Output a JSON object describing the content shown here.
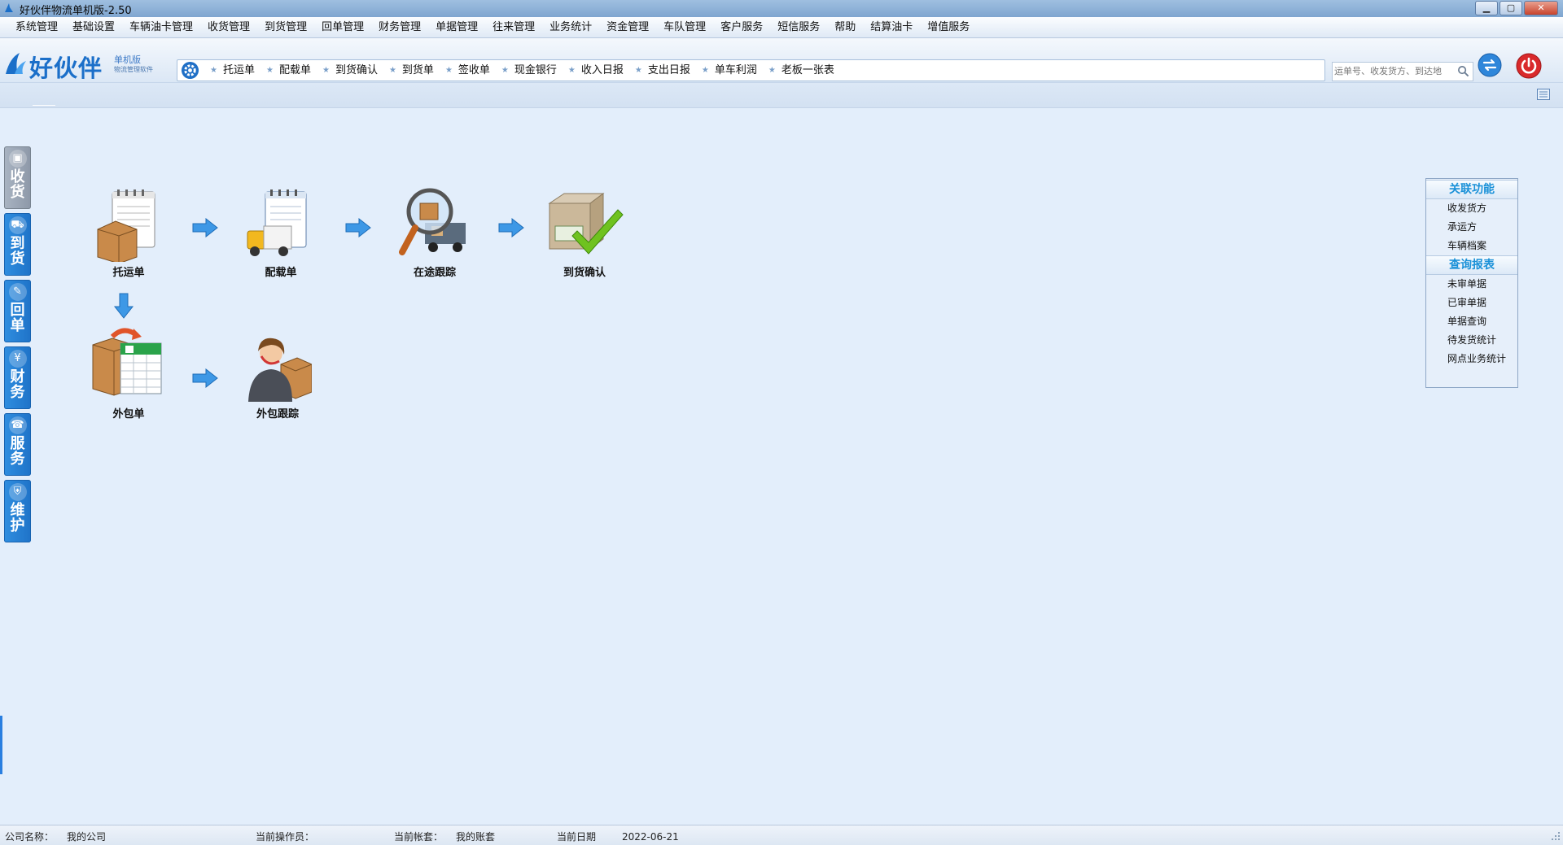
{
  "window": {
    "title": "好伙伴物流单机版-2.50",
    "controls": [
      "minimize-icon",
      "maximize-icon",
      "close-icon"
    ]
  },
  "menu": [
    "系统管理",
    "基础设置",
    "车辆油卡管理",
    "收货管理",
    "到货管理",
    "回单管理",
    "财务管理",
    "单据管理",
    "往来管理",
    "业务统计",
    "资金管理",
    "车队管理",
    "客户服务",
    "短信服务",
    "帮助",
    "结算油卡",
    "增值服务"
  ],
  "logo": {
    "name": "好伙伴",
    "edition": "单机版",
    "slogan": "物流管理软件"
  },
  "quickbar": [
    "托运单",
    "配载单",
    "到货确认",
    "到货单",
    "签收单",
    "现金银行",
    "收入日报",
    "支出日报",
    "单车利润",
    "老板一张表"
  ],
  "search": {
    "placeholder": "运单号、收发货方、到达地"
  },
  "lefttabs": [
    {
      "label": "收货",
      "icon": "box-icon",
      "active": true
    },
    {
      "label": "到货",
      "icon": "truck-icon",
      "active": false
    },
    {
      "label": "回单",
      "icon": "edit-icon",
      "active": false
    },
    {
      "label": "财务",
      "icon": "yen-icon",
      "active": false
    },
    {
      "label": "服务",
      "icon": "headset-icon",
      "active": false
    },
    {
      "label": "维护",
      "icon": "shield-icon",
      "active": false
    }
  ],
  "flow": {
    "consignment": "托运单",
    "loading": "配载单",
    "tracking": "在途跟踪",
    "arrival_confirm": "到货确认",
    "outsource": "外包单",
    "outsource_tracking": "外包跟踪"
  },
  "side_panel": {
    "related_title": "关联功能",
    "related": [
      "收发货方",
      "承运方",
      "车辆档案"
    ],
    "reports_title": "查询报表",
    "reports": [
      "未审单据",
      "已审单据",
      "单据查询",
      "待发货统计",
      "网点业务统计"
    ]
  },
  "status": {
    "company_label": "公司名称：",
    "company_value": "我的公司",
    "operator_label": "当前操作员：",
    "operator_value": "",
    "account_label": "当前帐套：",
    "account_value": "我的账套",
    "date_label": "当前日期",
    "date_value": "2022-06-21"
  },
  "colors": {
    "accent": "#1f73c8",
    "background": "#e3eefb",
    "panel_title": "#1a91d8"
  }
}
